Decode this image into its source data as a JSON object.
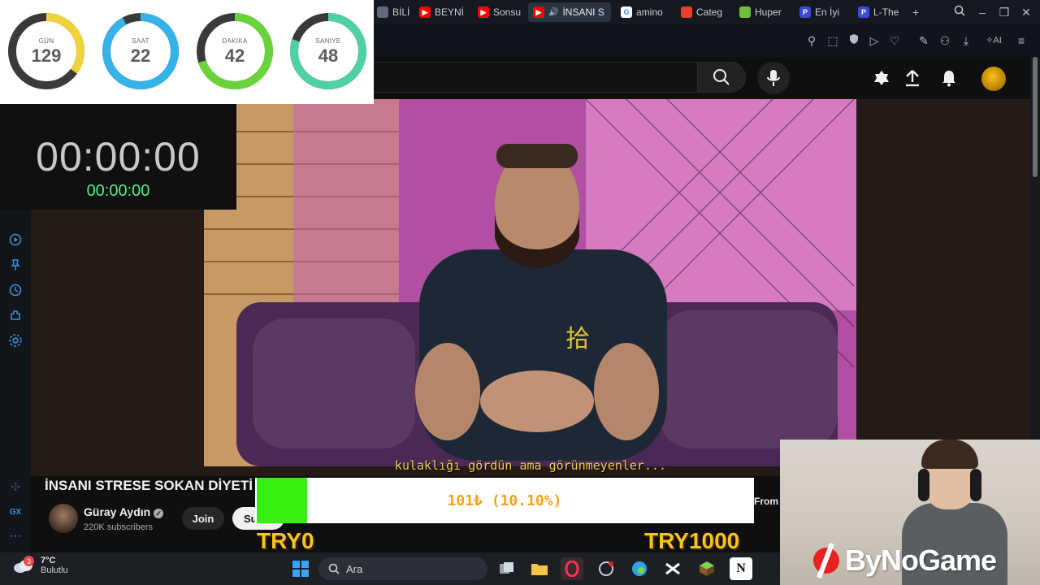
{
  "browser": {
    "tabs": [
      {
        "label": "BİLİMS",
        "favicon": "sphere-icon",
        "color": "#5f6b78"
      },
      {
        "label": "BEYNİ",
        "favicon": "youtube-icon",
        "color": "#ff0000"
      },
      {
        "label": "Sonsu",
        "favicon": "youtube-icon",
        "color": "#ff0000"
      },
      {
        "label": "İNSANI S",
        "favicon": "youtube-icon",
        "color": "#ff0000",
        "active": true
      },
      {
        "label": "amino",
        "favicon": "google-icon",
        "color": "#4285f4"
      },
      {
        "label": "Categ",
        "favicon": "flame-icon",
        "color": "#e8402a"
      },
      {
        "label": "Huper",
        "favicon": "gift-icon",
        "color": "#6fbf3a"
      },
      {
        "label": "En İyi",
        "favicon": "p-icon",
        "color": "#3b4bd8"
      },
      {
        "label": "L-The",
        "favicon": "p-icon",
        "color": "#3b4bd8"
      }
    ]
  },
  "countdown": {
    "units": [
      {
        "label": "GÜN",
        "value": "129",
        "color": "#f0d23c",
        "fraction": 0.35
      },
      {
        "label": "SAAT",
        "value": "22",
        "color": "#35b2e8",
        "fraction": 0.92
      },
      {
        "label": "DAKİKA",
        "value": "42",
        "color": "#6ad23a",
        "fraction": 0.7
      },
      {
        "label": "SANİYE",
        "value": "48",
        "color": "#4fd0a5",
        "fraction": 0.8
      }
    ],
    "track_color": "#3a3a3a"
  },
  "stopwatch": {
    "main": "00:00:00",
    "sub": "00:00:00"
  },
  "video": {
    "subtitle": "kulaklığı gördün ama görünmeyenler...",
    "title": "İNSANI STRESE SOKAN DİYETİ",
    "channel": "Güray Aydın",
    "subscribers": "220K subscribers",
    "join_label": "Join",
    "subscribe_label": "Su",
    "from_label": "From"
  },
  "donation": {
    "text": "101₺ (10.10%)",
    "progress_fraction": 0.101,
    "min_label": "TRY0",
    "max_label": "TRY1000"
  },
  "webcam": {
    "logo_text": "ByNoGame"
  },
  "taskbar": {
    "temperature": "7°C",
    "condition": "Bulutlu",
    "notif_count": "3",
    "search_placeholder": "Ara"
  },
  "sidebar_bottom": {
    "gx_label": "GX"
  }
}
